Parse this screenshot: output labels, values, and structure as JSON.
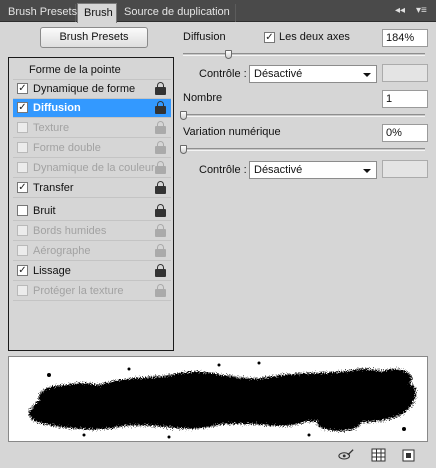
{
  "tabs": [
    {
      "label": "Brush Presets",
      "active": false
    },
    {
      "label": "Brush",
      "active": true
    },
    {
      "label": "Source de duplication",
      "active": false
    }
  ],
  "tabbar_controls": {
    "collapse": "◂◂",
    "menu": "▾≡"
  },
  "presets_button": "Brush Presets",
  "options": {
    "header": "Forme de la pointe",
    "items": [
      {
        "label": "Dynamique de forme",
        "checked": true,
        "enabled": true,
        "selected": false
      },
      {
        "label": "Diffusion",
        "checked": true,
        "enabled": true,
        "selected": true
      },
      {
        "label": "Texture",
        "checked": false,
        "enabled": false,
        "selected": false
      },
      {
        "label": "Forme double",
        "checked": false,
        "enabled": false,
        "selected": false
      },
      {
        "label": "Dynamique de la couleur",
        "checked": false,
        "enabled": false,
        "selected": false
      },
      {
        "label": "Transfer",
        "checked": true,
        "enabled": true,
        "selected": false
      },
      {
        "label": "Bruit",
        "checked": false,
        "enabled": true,
        "selected": false
      },
      {
        "label": "Bords humides",
        "checked": false,
        "enabled": false,
        "selected": false
      },
      {
        "label": "Aérographe",
        "checked": false,
        "enabled": false,
        "selected": false
      },
      {
        "label": "Lissage",
        "checked": true,
        "enabled": true,
        "selected": false
      },
      {
        "label": "Protéger la texture",
        "checked": false,
        "enabled": false,
        "selected": false
      }
    ]
  },
  "settings": {
    "diffusion": {
      "label": "Diffusion",
      "value": "184%",
      "slider_level": 0.18
    },
    "both_axes": {
      "label": "Les deux axes",
      "checked": true
    },
    "control1": {
      "label": "Contrôle :",
      "value": "Désactivé"
    },
    "count": {
      "label": "Nombre",
      "value": "1",
      "slider_level": 0.0
    },
    "count_jitter": {
      "label": "Variation numérique",
      "value": "0%",
      "slider_level": 0.0
    },
    "control2": {
      "label": "Contrôle :",
      "value": "Désactivé"
    }
  },
  "preview": {
    "description_icon": "brush-stroke-preview"
  },
  "bottom_icons": [
    "eye-brush-icon",
    "grid-icon",
    "new-preset-icon"
  ],
  "colors": {
    "tabbar": "#4a4a4a",
    "panel": "#d6d6d6",
    "selection": "#3399ff"
  }
}
